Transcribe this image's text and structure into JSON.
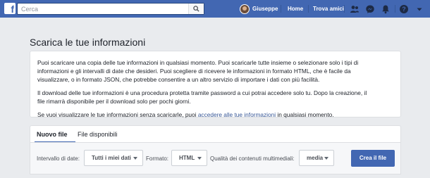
{
  "topbar": {
    "logo_letter": "f",
    "search_placeholder": "Cerca",
    "user_name": "Giuseppe",
    "home_label": "Home",
    "find_friends_label": "Trova amici",
    "icons": [
      "search-icon",
      "friend-requests-icon",
      "messenger-icon",
      "notifications-icon",
      "help-icon",
      "menu-caret-icon"
    ]
  },
  "page": {
    "title": "Scarica le tue informazioni",
    "info": {
      "p1_line1": "Puoi scaricare una copia delle tue informazioni in qualsiasi momento. Puoi scaricarle tutte insieme o selezionare solo i tipi di",
      "p1_line2": "informazioni e gli intervalli di date che desideri. Puoi scegliere di ricevere le informazioni in formato HTML, che è facile da",
      "p1_line3": "visualizzare, o in formato JSON, che potrebbe consentire a un altro servizio di importare i dati con più facilità.",
      "p2_line1": "Il download delle tue informazioni è una procedura protetta tramite password a cui potrai accedere solo tu. Dopo la creazione, il",
      "p2_line2": "file rimarrà disponibile per il download solo per pochi giorni.",
      "p3_before": "Se vuoi visualizzare le tue informazioni senza scaricarle, puoi ",
      "p3_link": "accedere alle tue informazioni",
      "p3_after": " in qualsiasi momento."
    },
    "tabs": {
      "new_file": "Nuovo file",
      "available_files": "File disponibili"
    },
    "filters": {
      "date_range_label": "Intervallo di date:",
      "date_range_value": "Tutti i miei dati",
      "format_label": "Formato:",
      "format_value": "HTML",
      "media_quality_label": "Qualità dei contenuti multimediali:",
      "media_quality_value": "media",
      "create_button": "Crea il file"
    }
  },
  "colors": {
    "brand": "#4267b2",
    "link": "#385898",
    "background": "#e9ebee"
  }
}
